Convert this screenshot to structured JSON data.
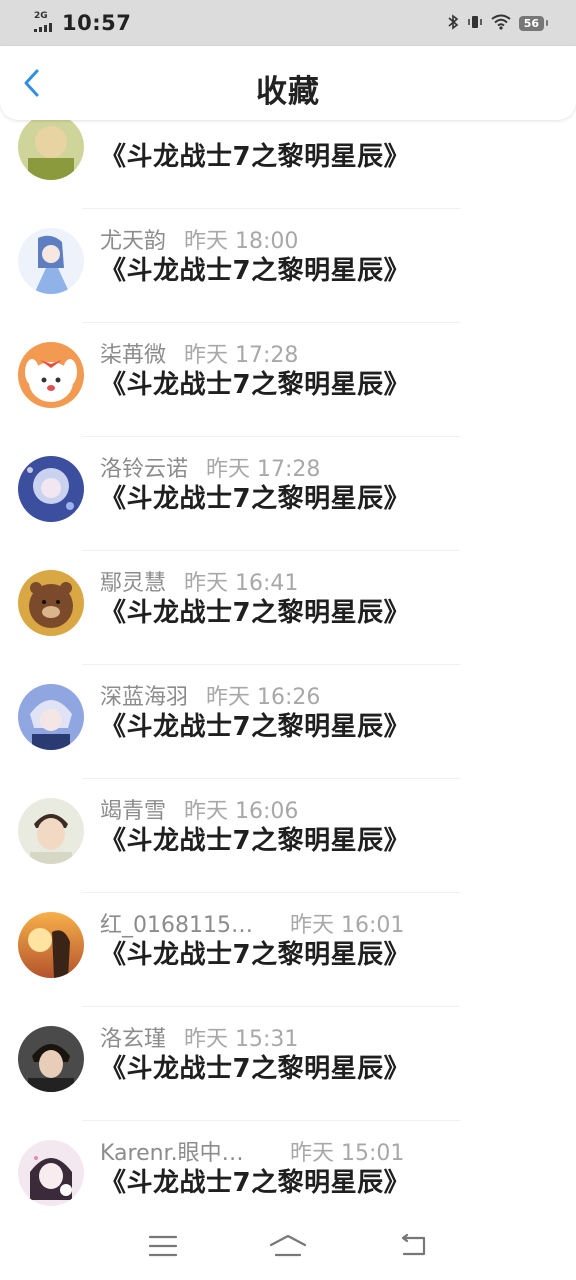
{
  "status_bar": {
    "network": "2G",
    "time": "10:57",
    "battery": "56",
    "icons": [
      "bluetooth-icon",
      "vibrate-icon",
      "wifi-icon",
      "battery-icon"
    ]
  },
  "header": {
    "title": "收藏",
    "back_icon": "chevron-left-icon",
    "accent_color": "#2f8fe0"
  },
  "items": [
    {
      "name": "",
      "time": "",
      "title": "《斗龙战士7之黎明星辰》",
      "avatar": "avatar-green"
    },
    {
      "name": "尤天韵",
      "time": "昨天  18:00",
      "title": "《斗龙战士7之黎明星辰》",
      "avatar": "avatar-blue-girl"
    },
    {
      "name": "柒苒微",
      "time": "昨天  17:28",
      "title": "《斗龙战士7之黎明星辰》",
      "avatar": "avatar-dog"
    },
    {
      "name": "洛铃云诺",
      "time": "昨天  17:28",
      "title": "《斗龙战士7之黎明星辰》",
      "avatar": "avatar-anime-purple"
    },
    {
      "name": "鄢灵慧",
      "time": "昨天  16:41",
      "title": "《斗龙战士7之黎明星辰》",
      "avatar": "avatar-bear"
    },
    {
      "name": "深蓝海羽",
      "time": "昨天  16:26",
      "title": "《斗龙战士7之黎明星辰》",
      "avatar": "avatar-anime-boy"
    },
    {
      "name": "竭青雪",
      "time": "昨天  16:06",
      "title": "《斗龙战士7之黎明星辰》",
      "avatar": "avatar-person"
    },
    {
      "name": "红_0168115…",
      "time": "昨天  16:01",
      "title": "《斗龙战士7之黎明星辰》",
      "avatar": "avatar-sunset"
    },
    {
      "name": "洛玄瑾",
      "time": "昨天  15:31",
      "title": "《斗龙战士7之黎明星辰》",
      "avatar": "avatar-dark-boy"
    },
    {
      "name": "Karenr.眼中…",
      "time": "昨天  15:01",
      "title": "《斗龙战士7之黎明星辰》",
      "avatar": "avatar-pink-girl"
    }
  ],
  "nav_bar": {
    "buttons": [
      "menu-icon",
      "home-icon",
      "back-icon"
    ]
  }
}
